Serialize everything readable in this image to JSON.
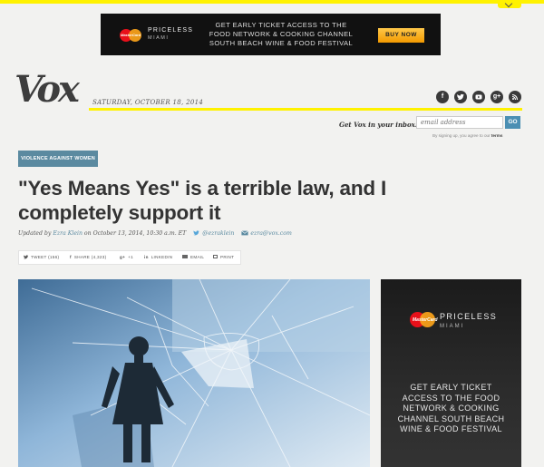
{
  "top_ad": {
    "brand_line1": "PRICELESS",
    "brand_line2": "MIAMI",
    "mastercard_text": "MasterCard",
    "copy": "GET EARLY TICKET ACCESS TO THE FOOD NETWORK & COOKING CHANNEL SOUTH BEACH WINE & FOOD FESTIVAL",
    "cta": "BUY NOW"
  },
  "masthead": {
    "logo": "Vox",
    "date": "SATURDAY, OCTOBER 18, 2014",
    "social_icons": [
      "facebook-icon",
      "twitter-icon",
      "youtube-icon",
      "google-plus-icon",
      "rss-icon"
    ],
    "accent_color": "#fff200"
  },
  "newsletter": {
    "label": "Get Vox in your inbox!",
    "placeholder": "email address",
    "button": "GO",
    "terms_prefix": "By signing up, you agree to our ",
    "terms_link": "terms"
  },
  "article": {
    "kicker": "VIOLENCE AGAINST WOMEN",
    "headline": "\"Yes Means Yes\" is a terrible law, and I completely support it",
    "byline_prefix": "Updated by ",
    "author": "Ezra Klein",
    "byline_date": " on October 13, 2014, 10:30 a.m. ET",
    "twitter_handle": "@ezraklein",
    "email": "ezra@vox.com"
  },
  "share_bar": {
    "tweet": "TWEET (156)",
    "facebook": "SHARE (4,323)",
    "gplus": "+1",
    "linkedin": "LINKEDIN",
    "email": "EMAIL",
    "print": "PRINT"
  },
  "side_ad": {
    "brand_line1": "PRICELESS",
    "brand_line2": "MIAMI",
    "mastercard_text": "MasterCard",
    "copy": "GET EARLY TICKET ACCESS TO THE FOOD NETWORK & COOKING CHANNEL SOUTH BEACH WINE & FOOD FESTIVAL"
  }
}
